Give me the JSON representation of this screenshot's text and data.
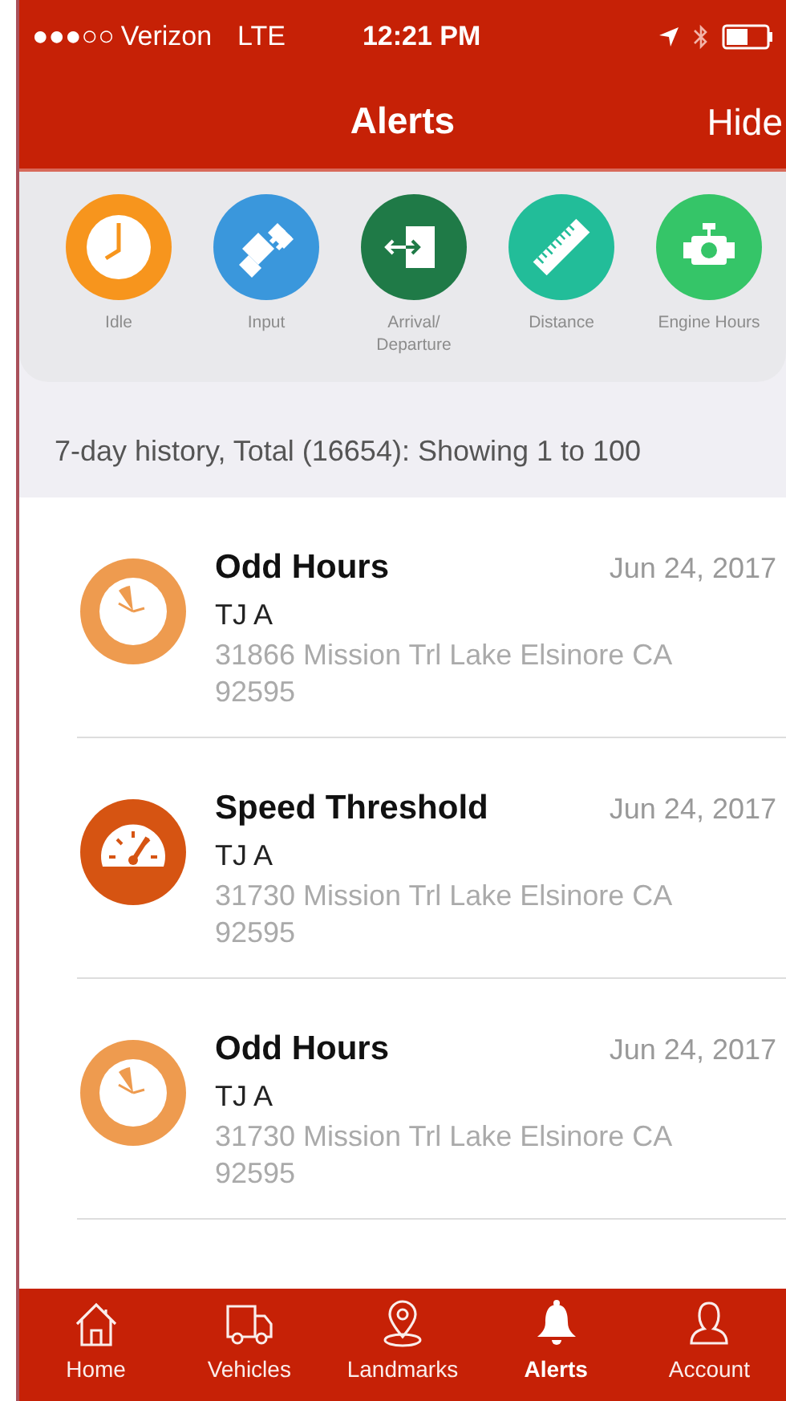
{
  "status_bar": {
    "signal": "●●●○○",
    "carrier": "Verizon",
    "network": "LTE",
    "time": "12:21 PM"
  },
  "nav": {
    "title": "Alerts",
    "action": "Hide"
  },
  "filters": [
    {
      "kind": "clock",
      "label": "Idle",
      "color": "#f7951d"
    },
    {
      "kind": "plug",
      "label": "Input",
      "color": "#3a97dc"
    },
    {
      "kind": "door",
      "label": "Arrival/ Departure",
      "color": "#1f7a47"
    },
    {
      "kind": "ruler",
      "label": "Distance",
      "color": "#22bd99"
    },
    {
      "kind": "engine",
      "label": "Engine Hours",
      "color": "#35c568"
    }
  ],
  "history_header": "7-day history, Total (16654): Showing 1 to 100",
  "alerts": [
    {
      "kind": "odd-hours",
      "title": "Odd Hours",
      "date": "Jun 24, 2017",
      "driver": "TJ A",
      "address": "31866 Mission Trl Lake Elsinore CA 92595"
    },
    {
      "kind": "speed",
      "title": "Speed Threshold",
      "date": "Jun 24, 2017",
      "driver": "TJ A",
      "address": "31730 Mission Trl Lake Elsinore CA 92595"
    },
    {
      "kind": "odd-hours",
      "title": "Odd Hours",
      "date": "Jun 24, 2017",
      "driver": "TJ A",
      "address": "31730 Mission Trl Lake Elsinore CA 92595"
    }
  ],
  "tab_bar": [
    {
      "kind": "home",
      "label": "Home",
      "selected": false
    },
    {
      "kind": "truck",
      "label": "Vehicles",
      "selected": false
    },
    {
      "kind": "pin",
      "label": "Landmarks",
      "selected": false
    },
    {
      "kind": "bell",
      "label": "Alerts",
      "selected": true
    },
    {
      "kind": "person",
      "label": "Account",
      "selected": false
    }
  ]
}
